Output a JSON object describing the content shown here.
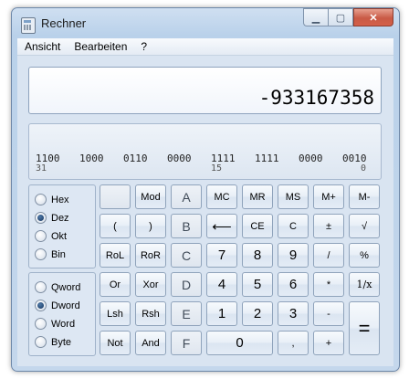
{
  "window": {
    "title": "Rechner"
  },
  "menu": [
    "Ansicht",
    "Bearbeiten",
    "?"
  ],
  "display": {
    "value": "-933167358"
  },
  "binary": {
    "groups": [
      "1100",
      "1000",
      "0110",
      "0000",
      "1111",
      "1111",
      "0000",
      "0010"
    ],
    "positions": [
      "31",
      "15",
      "0"
    ]
  },
  "base_options": {
    "items": [
      "Hex",
      "Dez",
      "Okt",
      "Bin"
    ],
    "selected": "Dez"
  },
  "word_options": {
    "items": [
      "Qword",
      "Dword",
      "Word",
      "Byte"
    ],
    "selected": "Dword"
  },
  "buttons": {
    "mod": "Mod",
    "a": "A",
    "mc": "MC",
    "mr": "MR",
    "ms": "MS",
    "mplus": "M+",
    "mminus": "M-",
    "lparen": "(",
    "rparen": ")",
    "b": "B",
    "backspace": "⟵",
    "ce": "CE",
    "c": "C",
    "plusminus": "±",
    "sqrt": "√",
    "rol": "RoL",
    "ror": "RoR",
    "hc": "C",
    "n7": "7",
    "n8": "8",
    "n9": "9",
    "div": "/",
    "pct": "%",
    "or": "Or",
    "xor": "Xor",
    "d": "D",
    "n4": "4",
    "n5": "5",
    "n6": "6",
    "mul": "*",
    "recip": "1/x",
    "lsh": "Lsh",
    "rsh": "Rsh",
    "e": "E",
    "n1": "1",
    "n2": "2",
    "n3": "3",
    "minus": "-",
    "not": "Not",
    "and": "And",
    "f": "F",
    "n0": "0",
    "dot": ",",
    "plus": "+",
    "eq": "="
  }
}
